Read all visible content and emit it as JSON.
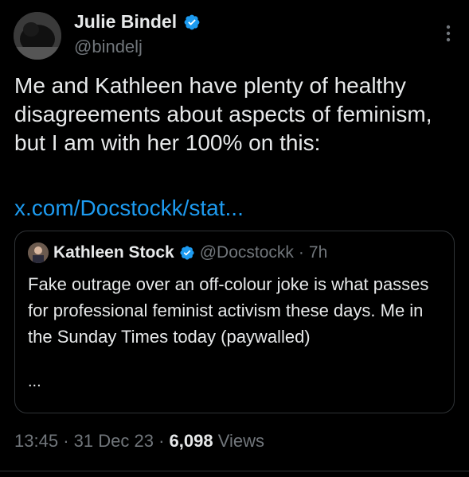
{
  "author": {
    "display_name": "Julie Bindel",
    "handle": "@bindelj",
    "verified": true
  },
  "tweet": {
    "text": "Me and Kathleen have plenty of healthy disagreements about aspects of feminism, but I am with her 100% on this:",
    "link": "x.com/Docstockk/stat..."
  },
  "quote": {
    "display_name": "Kathleen Stock",
    "handle": "@Docstockk",
    "separator": "·",
    "time": "7h",
    "text": "Fake outrage over an off-colour joke is what passes for professional feminist activism these days. Me in the Sunday Times today (paywalled)",
    "ellipsis": "..."
  },
  "meta": {
    "time": "13:45",
    "sep1": "·",
    "date": "31 Dec 23",
    "sep2": "·",
    "views_count": "6,098",
    "views_label": "Views"
  },
  "colors": {
    "background": "#000000",
    "text": "#e7e9ea",
    "secondary": "#71767b",
    "link": "#1d9bf0",
    "verified": "#1d9bf0",
    "border": "#2f3336"
  },
  "icons": {
    "verified": "verified-badge-icon",
    "more": "more-vertical-icon"
  }
}
